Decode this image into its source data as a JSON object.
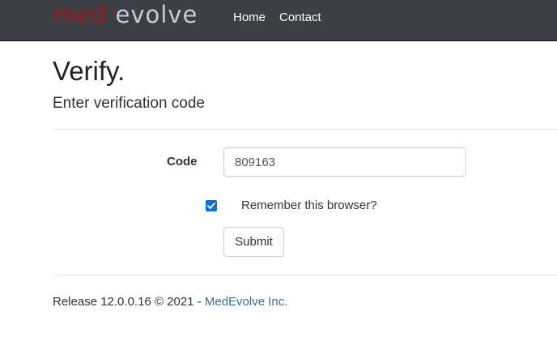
{
  "navbar": {
    "brand_med": "med",
    "brand_evolve": "evolve",
    "links": [
      {
        "label": "Home"
      },
      {
        "label": "Contact"
      }
    ],
    "colors": {
      "background": "#3c3f44",
      "brand_med": "#9b1b1e",
      "brand_evolve": "#c8ccd2"
    }
  },
  "main": {
    "title": "Verify.",
    "subtitle": "Enter verification code",
    "code_label": "Code",
    "code_value": "809163",
    "remember_label": "Remember this browser?",
    "remember_checked": true,
    "submit_label": "Submit"
  },
  "footer": {
    "release_text": "Release 12.0.0.16 © 2021 - ",
    "company_link": "MedEvolve Inc."
  },
  "colors": {
    "accent_checkbox": "#0b6fd6",
    "link": "#3a6d99"
  }
}
